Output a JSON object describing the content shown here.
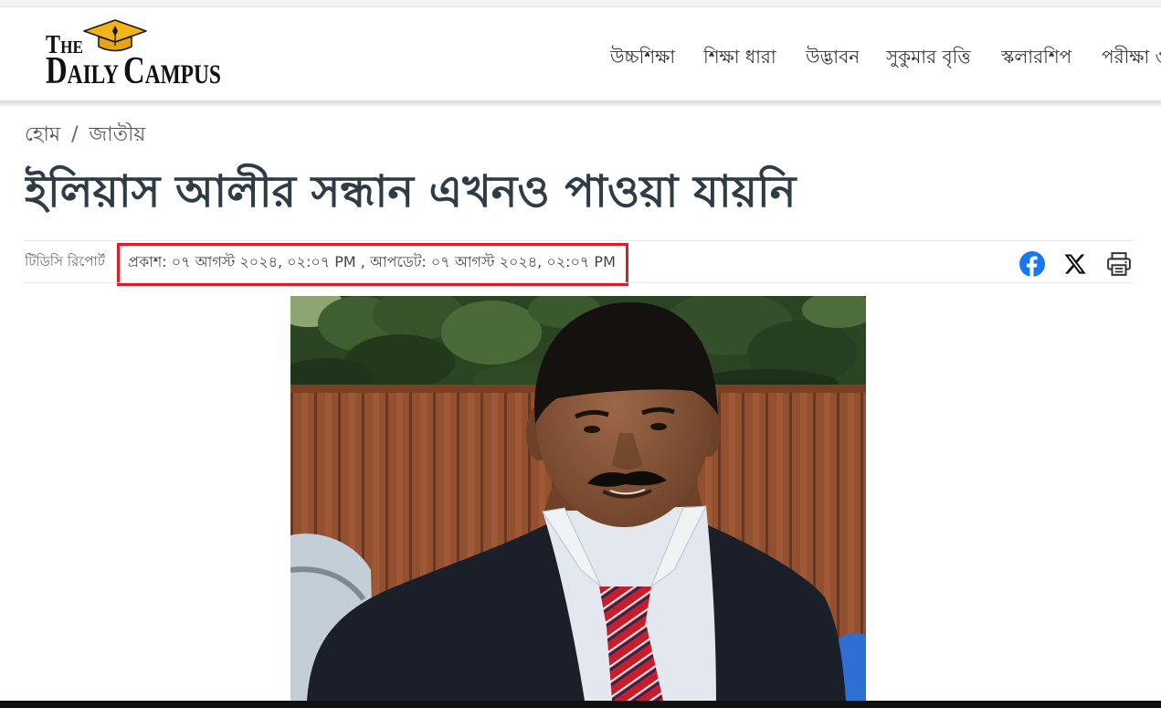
{
  "logo": {
    "the": "THE",
    "name": "DAILY CAMPUS"
  },
  "nav": {
    "items": [
      {
        "label": "উচ্চশিক্ষা"
      },
      {
        "label": "শিক্ষা ধারা"
      },
      {
        "label": "উদ্ভাবন"
      },
      {
        "label": "সুকুমার বৃত্তি"
      },
      {
        "label": "স্কলারশিপ"
      },
      {
        "label": "পরীক্ষা ও"
      }
    ]
  },
  "breadcrumb": {
    "home": "হোম",
    "separator": "/",
    "category": "জাতীয়"
  },
  "article": {
    "headline": "ইলিয়াস আলীর সন্ধান এখনও পাওয়া যায়নি",
    "author": "টিডিসি রিপোর্ট",
    "published_label": "প্রকাশ:",
    "published": "০৭ আগস্ট ২০২৪, ০২:০৭ PM",
    "separator": ",",
    "updated_label": "আপডেট:",
    "updated": "০৭ আগস্ট ২০২৪, ০২:০৭ PM"
  },
  "share": {
    "icons": [
      "facebook-icon",
      "x-icon",
      "print-icon"
    ]
  },
  "colors": {
    "headline": "#2e3c46",
    "highlight_box": "#e31b23",
    "facebook": "#1877f2",
    "logo_cap": "#f3b31b"
  }
}
